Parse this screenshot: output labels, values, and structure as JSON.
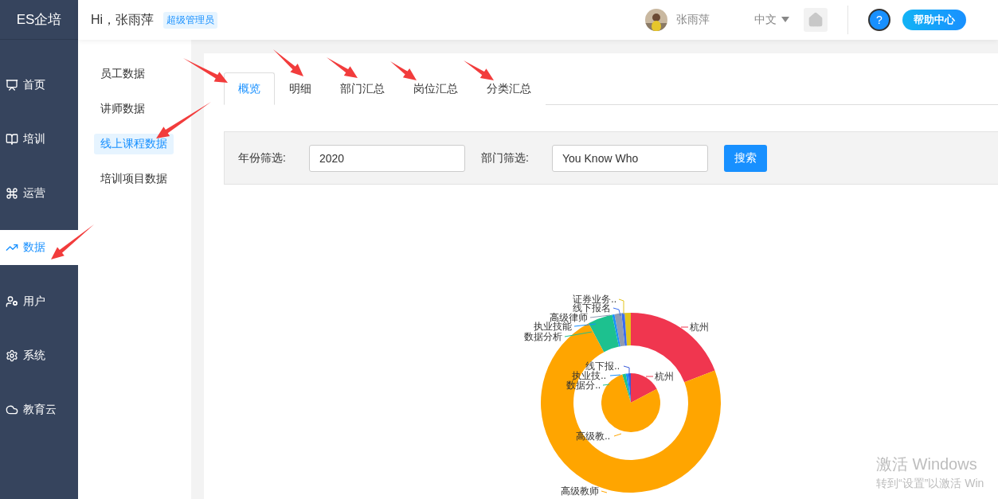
{
  "app": {
    "logo": "ES企培"
  },
  "header": {
    "greeting": "Hi，张雨萍",
    "role_badge": "超级管理员",
    "user_name": "张雨萍",
    "language": "中文",
    "help_mark": "?",
    "help_label": "帮助中心"
  },
  "nav": [
    {
      "label": "首页",
      "selected": false
    },
    {
      "label": "培训",
      "selected": false
    },
    {
      "label": "运营",
      "selected": false
    },
    {
      "label": "数据",
      "selected": true
    },
    {
      "label": "用户",
      "selected": false
    },
    {
      "label": "系统",
      "selected": false
    },
    {
      "label": "教育云",
      "selected": false
    }
  ],
  "submenu": [
    {
      "label": "员工数据",
      "selected": false
    },
    {
      "label": "讲师数据",
      "selected": false
    },
    {
      "label": "线上课程数据",
      "selected": true
    },
    {
      "label": "培训项目数据",
      "selected": false
    }
  ],
  "tabs": [
    {
      "label": "概览",
      "selected": true
    },
    {
      "label": "明细",
      "selected": false
    },
    {
      "label": "部门汇总",
      "selected": false
    },
    {
      "label": "岗位汇总",
      "selected": false
    },
    {
      "label": "分类汇总",
      "selected": false
    }
  ],
  "filters": {
    "year_label": "年份筛选:",
    "year_value": "2020",
    "dept_label": "部门筛选:",
    "dept_value": "You Know Who",
    "search_button": "搜索"
  },
  "chart": {
    "outer": [
      {
        "label": "证券业务..",
        "color": "#e3c41a"
      },
      {
        "label": "线下报名",
        "color": "#3a6df0"
      },
      {
        "label": "高级律师",
        "color": "#8f9bb3"
      },
      {
        "label": "执业技能",
        "color": "#1890ff"
      },
      {
        "label": "杭州",
        "color": "#f0364f"
      },
      {
        "label": "数据分析",
        "color": "#1dc18f"
      },
      {
        "label": "高级教师",
        "color": "#ffa500"
      }
    ],
    "inner": [
      {
        "label": "线下报..",
        "color": "#3a5bd9"
      },
      {
        "label": "执业技..",
        "color": "#1890ff"
      },
      {
        "label": "杭州",
        "color": "#f0364f"
      },
      {
        "label": "数据分..",
        "color": "#1dc18f"
      },
      {
        "label": "高级教..",
        "color": "#ffa500"
      }
    ]
  },
  "annotations": [
    {
      "kind": "arrow"
    },
    {
      "kind": "arrow"
    },
    {
      "kind": "arrow"
    },
    {
      "kind": "arrow"
    },
    {
      "kind": "arrow"
    },
    {
      "kind": "arrow"
    },
    {
      "kind": "arrow"
    }
  ],
  "os_notice": {
    "title": "激活 Windows",
    "text": "转到“设置”以激活 Win"
  }
}
